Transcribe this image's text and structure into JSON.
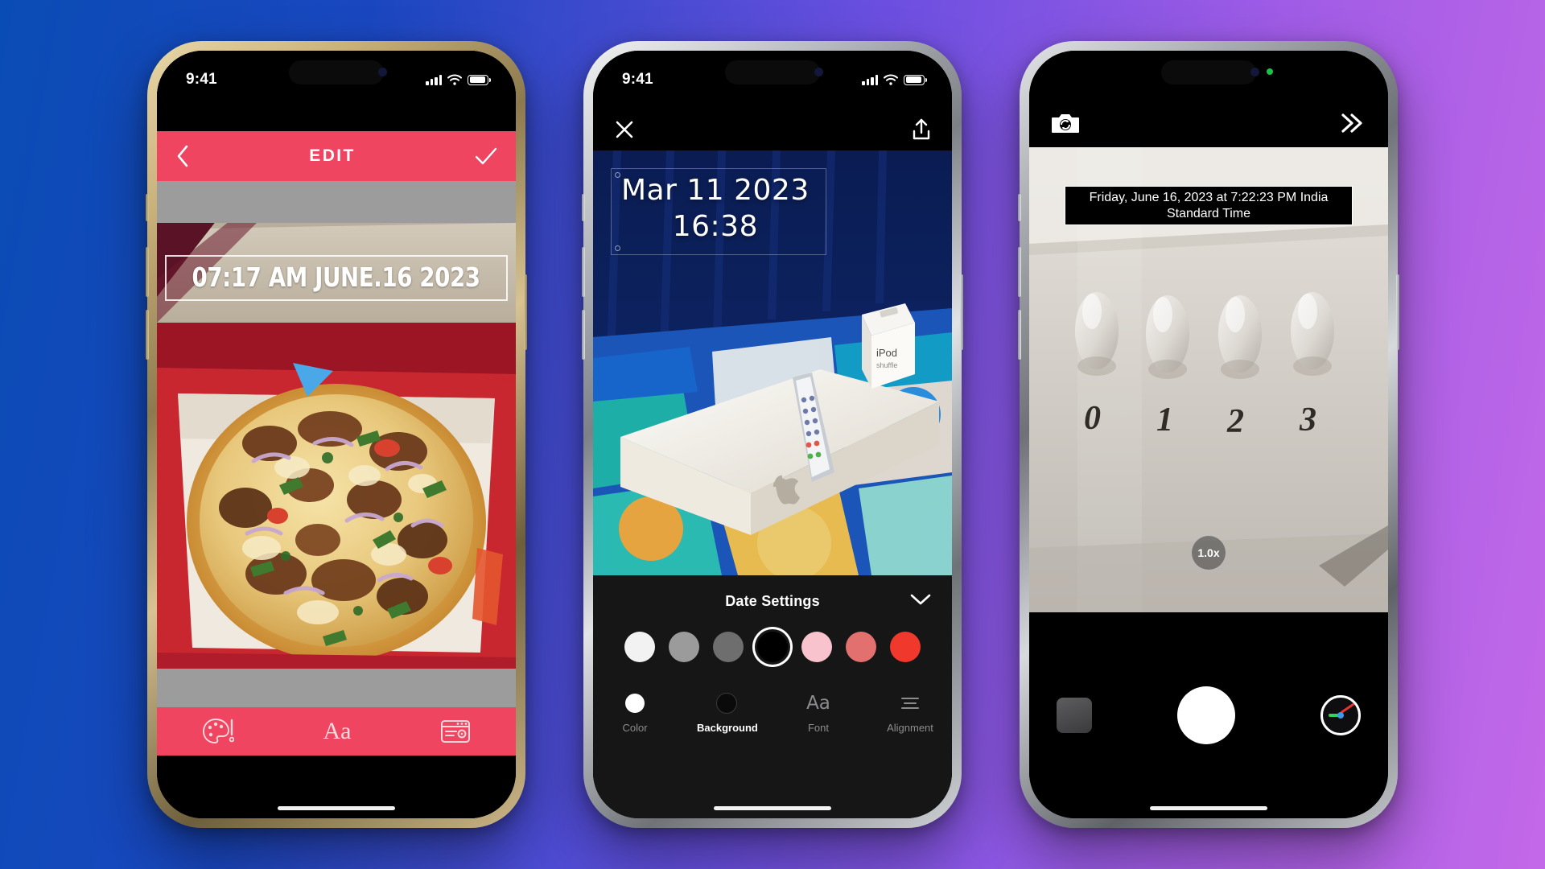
{
  "background": {
    "from": "#0a4cb5",
    "to": "#c368e8"
  },
  "accent_pink": "#ef4560",
  "phones": [
    {
      "id": "phone-edit",
      "frame": "gold",
      "status_bar": {
        "time": "9:41",
        "signal": "signal-icon",
        "wifi": "wifi-icon",
        "battery": "battery-icon"
      },
      "navbar": {
        "back": "chevron-left-icon",
        "title": "EDIT",
        "confirm": "checkmark-icon"
      },
      "stamp": {
        "text": "07:17 AM JUNE.16 2023"
      },
      "toolbar": {
        "items": [
          {
            "name": "color-palette",
            "icon": "palette-icon",
            "label": ""
          },
          {
            "name": "font",
            "icon": "Aa",
            "label": "Aa"
          },
          {
            "name": "date-settings",
            "icon": "date-settings-icon",
            "label": ""
          }
        ]
      }
    },
    {
      "id": "phone-date-settings",
      "frame": "silver",
      "status_bar": {
        "time": "9:41",
        "signal": "signal-icon",
        "wifi": "wifi-icon",
        "battery": "battery-icon"
      },
      "actionbar": {
        "close": "close-icon",
        "share": "share-icon"
      },
      "stamp": {
        "line1": "Mar 11 2023",
        "line2": "16:38"
      },
      "panel": {
        "title": "Date Settings",
        "collapse": "chevron-down-icon",
        "swatches": [
          {
            "color": "#f2f2f2",
            "selected": false
          },
          {
            "color": "#9b9b9b",
            "selected": false
          },
          {
            "color": "#6e6e6e",
            "selected": false
          },
          {
            "color": "#000000",
            "selected": true
          },
          {
            "color": "#f8c3cd",
            "selected": false
          },
          {
            "color": "#e2706f",
            "selected": false
          },
          {
            "color": "#f0382c",
            "selected": false
          }
        ],
        "tabs": [
          {
            "label": "Color",
            "icon": "white-circle-icon",
            "active": false
          },
          {
            "label": "Background",
            "icon": "black-circle-icon",
            "active": true
          },
          {
            "label": "Font",
            "icon": "Aa",
            "active": false
          },
          {
            "label": "Alignment",
            "icon": "alignment-icon",
            "active": false
          }
        ]
      }
    },
    {
      "id": "phone-camera",
      "frame": "graphite",
      "status_bar": {
        "time": "",
        "signal": "",
        "wifi": "",
        "battery": ""
      },
      "controlbar": {
        "flip": "camera-flip-icon",
        "more": "double-chevron-right-icon"
      },
      "stamp": {
        "text": "Friday, June 16, 2023 at 7:22:23 PM India Standard Time"
      },
      "zoom_badge": "1.0x",
      "controls": {
        "thumbnail": "photo-thumbnail",
        "shutter": "shutter-button",
        "level": "level-indicator"
      }
    }
  ]
}
